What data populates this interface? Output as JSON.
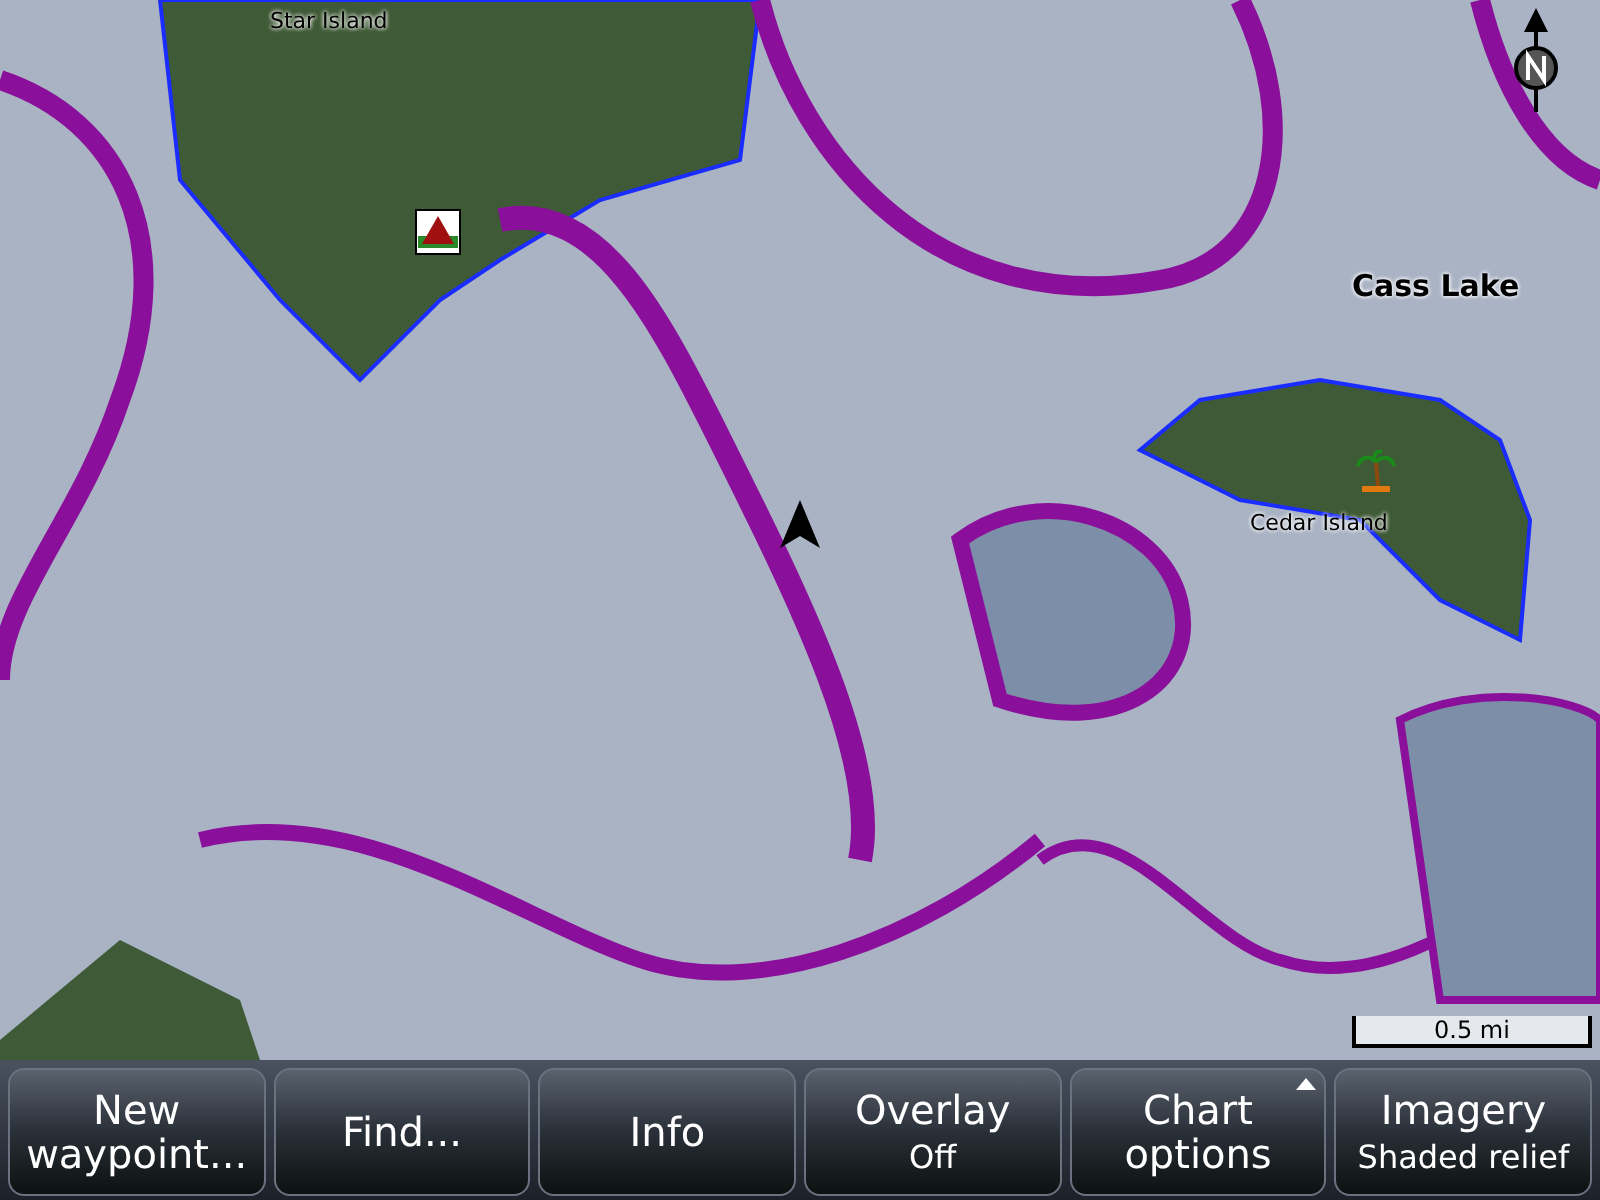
{
  "map": {
    "labels": [
      {
        "kind": "island",
        "text": "Star Island"
      },
      {
        "kind": "lake",
        "text": "Cass Lake"
      },
      {
        "kind": "island",
        "text": "Cedar Island"
      }
    ],
    "scale": {
      "text": "0.5 mi"
    }
  },
  "softkeys": [
    {
      "label": "New waypoint...",
      "menu": false
    },
    {
      "label": "Find...",
      "menu": false
    },
    {
      "label": "Info",
      "menu": false
    },
    {
      "label": "Overlay",
      "value": "Off",
      "menu": false
    },
    {
      "label": "Chart options",
      "menu": true
    },
    {
      "label": "Imagery",
      "value": "Shaded relief",
      "menu": false
    }
  ]
}
